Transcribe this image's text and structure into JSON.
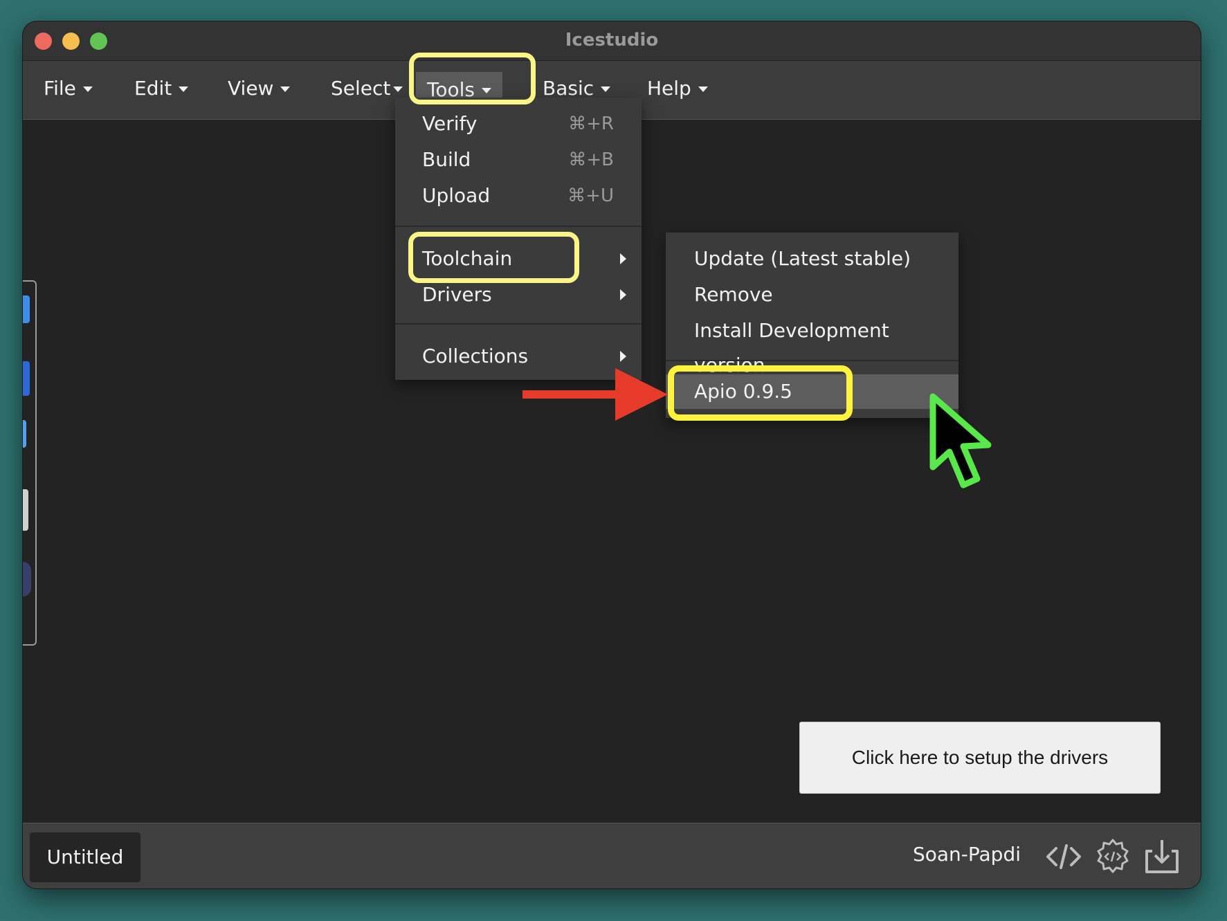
{
  "window": {
    "title": "Icestudio"
  },
  "menubar": {
    "items": [
      {
        "label": "File"
      },
      {
        "label": "Edit"
      },
      {
        "label": "View"
      },
      {
        "label": "Select"
      },
      {
        "label": "Tools"
      },
      {
        "label": "Basic"
      },
      {
        "label": "Help"
      }
    ]
  },
  "tools_menu": {
    "items": [
      {
        "label": "Verify",
        "shortcut": "⌘+R"
      },
      {
        "label": "Build",
        "shortcut": "⌘+B"
      },
      {
        "label": "Upload",
        "shortcut": "⌘+U"
      },
      {
        "label": "Toolchain"
      },
      {
        "label": "Drivers"
      },
      {
        "label": "Collections"
      }
    ]
  },
  "toolchain_submenu": {
    "items": [
      {
        "label": "Update (Latest stable)"
      },
      {
        "label": "Remove"
      },
      {
        "label": "Install Development version"
      },
      {
        "label": "Apio 0.9.5"
      }
    ]
  },
  "canvas": {
    "drivers_button": "Click here to setup the drivers"
  },
  "statusbar": {
    "file_tab": "Untitled",
    "board": "Soan-Papdi"
  },
  "icons": [
    "code-icon",
    "settings-code-icon",
    "download-icon"
  ],
  "annotations": {
    "highlight_color": "#fbf486",
    "strong_highlight_color": "#fff23c",
    "arrow_color": "#e63b2a",
    "cursor_color": "#59e84a"
  }
}
